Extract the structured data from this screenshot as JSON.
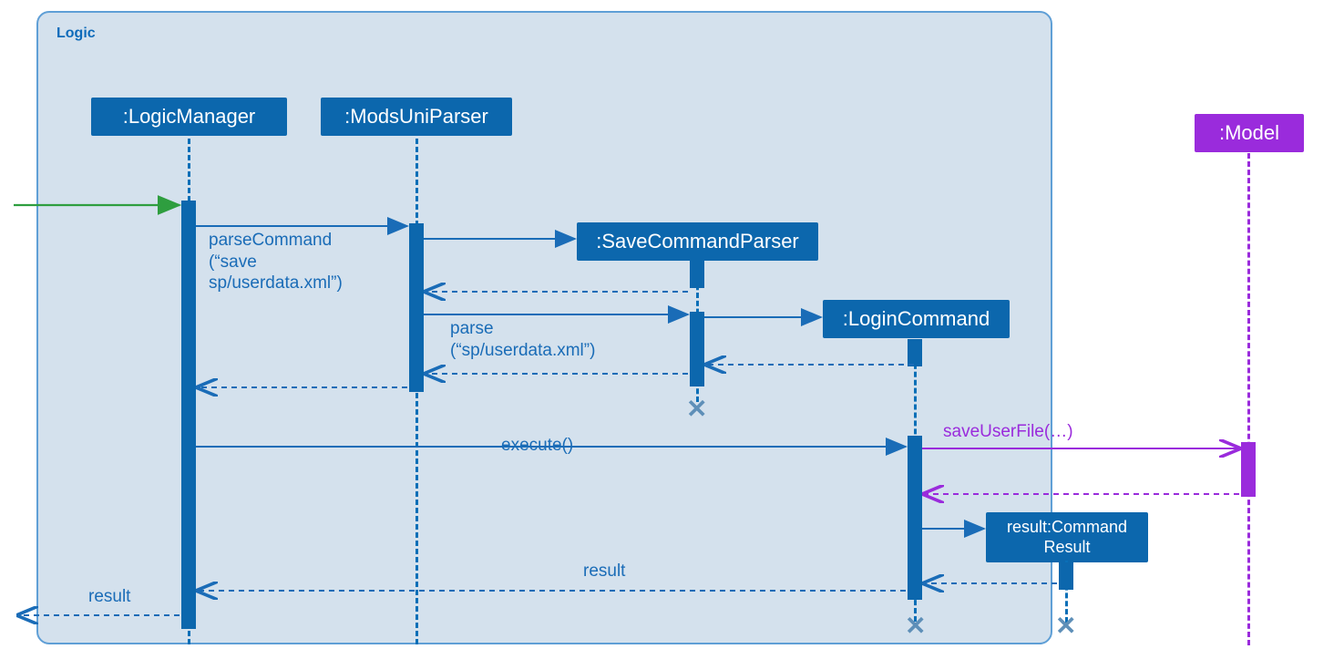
{
  "frame_label": "Logic",
  "objects": {
    "logicManager": ":LogicManager",
    "modsUniParser": ":ModsUniParser",
    "saveCommandParser": ":SaveCommandParser",
    "loginCommand": ":LoginCommand",
    "commandResult": "result:Command\nResult",
    "model": ":Model"
  },
  "messages": {
    "parseCommand1": "parseCommand",
    "parseCommand2": "(“save",
    "parseCommand3": "sp/userdata.xml”)",
    "parse1": "parse",
    "parse2": "(“sp/userdata.xml”)",
    "execute": "execute()",
    "saveUserFile": "saveUserFile(…)",
    "result": "result",
    "resultReturn": "result"
  },
  "colors": {
    "frameBg": "#d4e1ed",
    "frameBorder": "#5f9fd6",
    "blue": "#0c67ad",
    "blueText": "#1a6cb7",
    "purple": "#9a2bdc",
    "green": "#2e9e3f"
  }
}
